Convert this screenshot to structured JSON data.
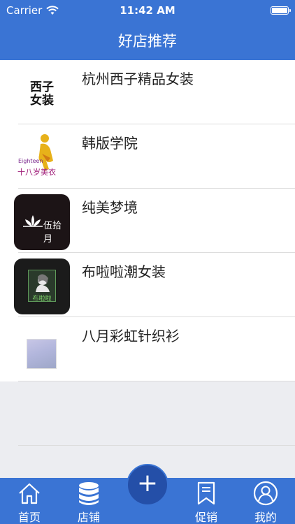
{
  "status": {
    "carrier": "Carrier",
    "time": "11:42 AM"
  },
  "nav": {
    "title": "好店推荐"
  },
  "shops": [
    {
      "name": "杭州西子精品女装",
      "logo_text_1": "西子",
      "logo_text_2": "女装"
    },
    {
      "name": "韩版学院",
      "logo_text_1": "Eighteen",
      "logo_text_2": "十八岁美衣"
    },
    {
      "name": "纯美梦境",
      "logo_text_1": "伍拾月"
    },
    {
      "name": "布啦啦潮女装",
      "logo_text_1": "布啦啦"
    },
    {
      "name": "八月彩虹针织衫"
    }
  ],
  "tabs": {
    "home": "首页",
    "shops": "店铺",
    "promo": "促销",
    "mine": "我的"
  },
  "fab": {
    "label": "+"
  },
  "colors": {
    "primary": "#3a74d4",
    "fab": "#244fa8"
  },
  "icons": [
    "wifi-icon",
    "battery-icon",
    "home-icon",
    "database-icon",
    "bookmark-icon",
    "user-icon",
    "plus-icon"
  ]
}
